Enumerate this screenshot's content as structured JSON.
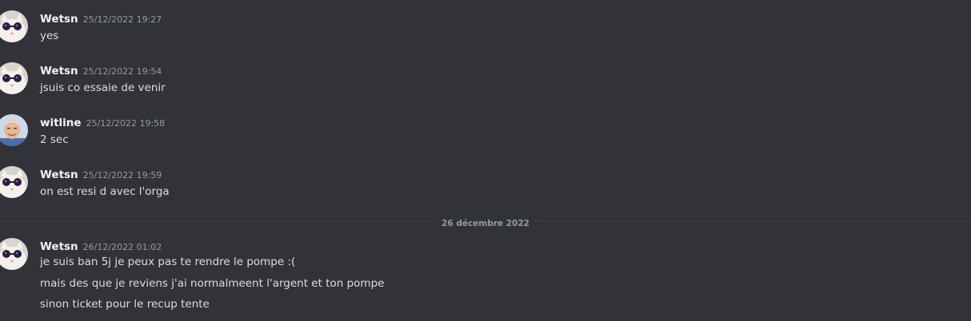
{
  "colors": {
    "background": "#313338",
    "username": "#f2f3f5",
    "timestamp": "#949ba4",
    "text": "#dbdee1",
    "divider": "#3f4147"
  },
  "messages": [
    {
      "author": "Wetsn",
      "avatar_icon": "cat-sunglasses-avatar-icon",
      "timestamp": "25/12/2022 19:27",
      "lines": [
        "yes"
      ]
    },
    {
      "author": "Wetsn",
      "avatar_icon": "cat-sunglasses-avatar-icon",
      "timestamp": "25/12/2022 19:54",
      "lines": [
        "jsuis co essaie de venir"
      ]
    },
    {
      "author": "witline",
      "avatar_icon": "old-man-avatar-icon",
      "timestamp": "25/12/2022 19:58",
      "lines": [
        "2 sec"
      ]
    },
    {
      "author": "Wetsn",
      "avatar_icon": "cat-sunglasses-avatar-icon",
      "timestamp": "25/12/2022 19:59",
      "lines": [
        "on est resi d avec l'orga"
      ]
    },
    {
      "author": "Wetsn",
      "avatar_icon": "cat-sunglasses-avatar-icon",
      "timestamp": "26/12/2022 01:02",
      "lines": [
        "je suis ban 5j je peux pas te rendre le pompe :(",
        "mais des que je reviens j'ai normalmeent l'argent et ton pompe",
        "sinon ticket pour le recup tente"
      ]
    }
  ],
  "date_divider": {
    "label": "26 décembre 2022"
  }
}
